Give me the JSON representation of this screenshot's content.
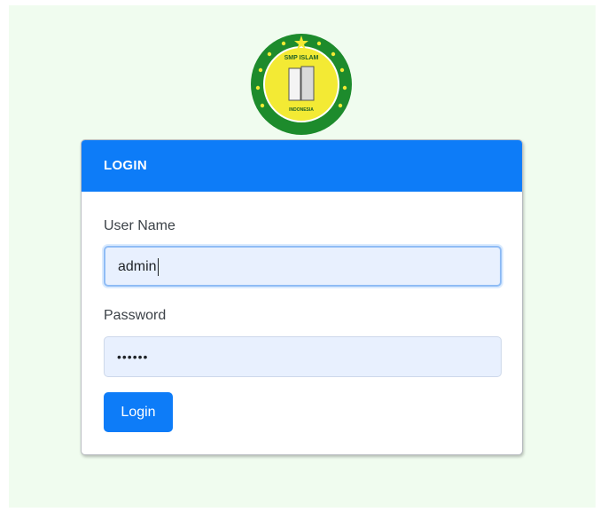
{
  "logo": {
    "alt": "SMP Islam emblem",
    "ring_text": "SMP ISLAM",
    "bottom_text": "INDONESIA",
    "colors": {
      "ring": "#1d8b2c",
      "inner": "#f3ea34",
      "stars": "#f3ea34"
    },
    "icon": "book-icon"
  },
  "login_form": {
    "header_title": "LOGIN",
    "username_label": "User Name",
    "username_value": "admin",
    "password_label": "Password",
    "password_mask": "••••••",
    "submit_label": "Login"
  },
  "colors": {
    "accent": "#0d7cf8",
    "page_background": "#f0fcef",
    "input_background": "#e8f0fe"
  }
}
